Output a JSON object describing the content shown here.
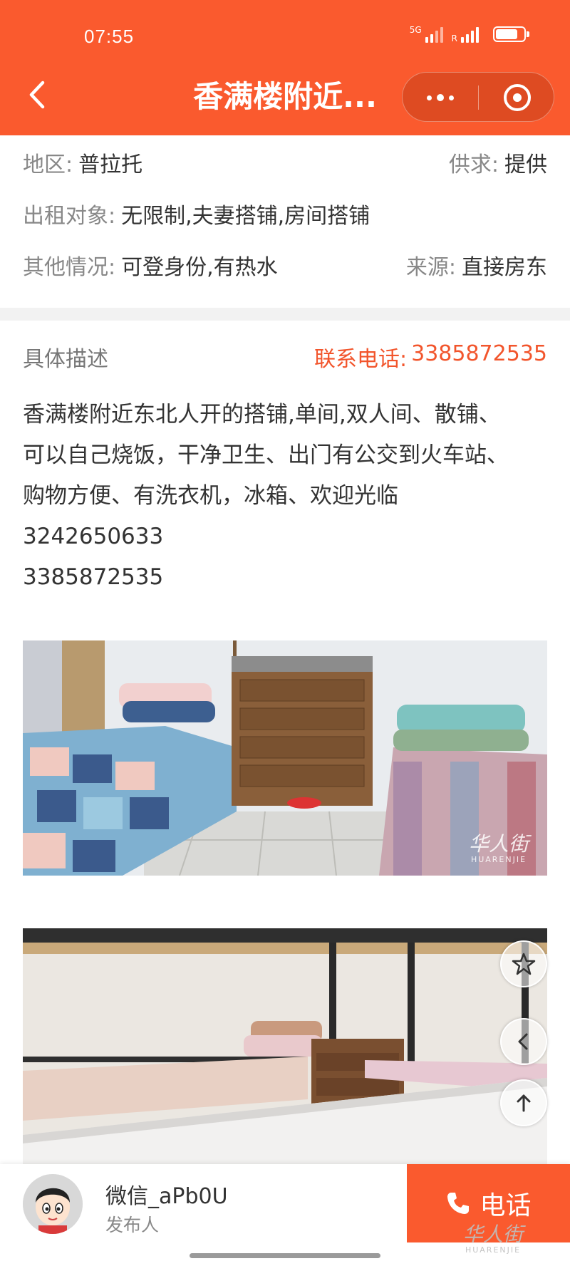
{
  "status_bar": {
    "time": "07:55",
    "network": "5G",
    "carrier_label": "R"
  },
  "nav": {
    "title": "香满楼附近..."
  },
  "info": {
    "area": {
      "label": "地区:",
      "value": "普拉托"
    },
    "supply": {
      "label": "供求:",
      "value": "提供"
    },
    "rent_target": {
      "label": "出租对象:",
      "value": "无限制,夫妻搭铺,房间搭铺"
    },
    "other": {
      "label": "其他情况:",
      "value": "可登身份,有热水"
    },
    "source": {
      "label": "来源:",
      "value": "直接房东"
    }
  },
  "description": {
    "title": "具体描述",
    "contact_label": "联系电话:",
    "contact_phone": "3385872535",
    "lines": [
      "香满楼附近东北人开的搭铺,单间,双人间、散铺、",
      "可以自己烧饭，干净卫生、出门有公交到火车站、",
      "购物方便、有洗衣机，冰箱、欢迎光临",
      "3242650633",
      "3385872535"
    ]
  },
  "watermark": {
    "main": "华人街",
    "sub": "HUARENJIE"
  },
  "publisher": {
    "name": "微信_aPb0U",
    "role": "发布人"
  },
  "actions": {
    "call_label": "电话"
  },
  "icons": {
    "back": "back-chevron-icon",
    "more": "more-dots-icon",
    "close": "close-target-icon",
    "favorite": "star-icon",
    "previous": "chevron-left-icon",
    "top": "arrow-up-icon",
    "phone": "phone-icon"
  },
  "colors": {
    "brand": "#fa5a2e",
    "contact_text": "#f2552c",
    "label_text": "#888888",
    "body_text": "#333333"
  }
}
